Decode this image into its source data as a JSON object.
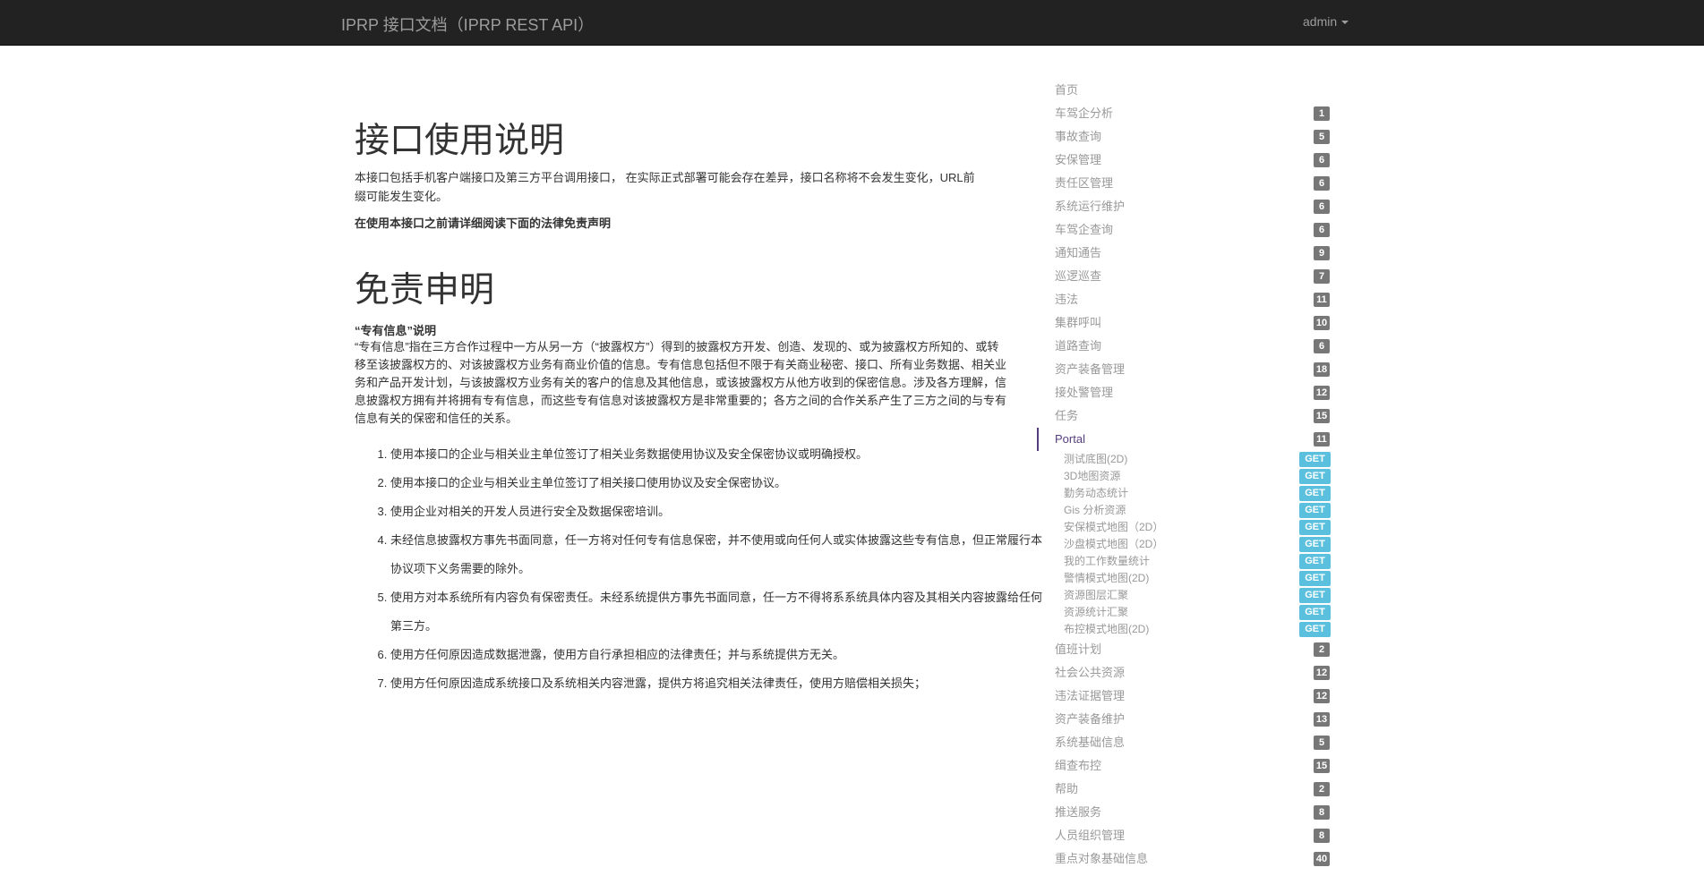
{
  "navbar": {
    "brand": "IPRP 接口文档（IPRP REST API）",
    "user": "admin"
  },
  "main": {
    "usage_title": "接口使用说明",
    "intro": "本接口包括手机客户端接口及第三方平台调用接口， 在实际正式部署可能会存在差异，接口名称将不会发生变化，URL前缀可能发生变化。",
    "warning": "在使用本接口之前请详细阅读下面的法律免责声明",
    "disclaimer_title": "免责申明",
    "proprietary_title": "“专有信息”说明",
    "proprietary_text": "“专有信息”指在三方合作过程中一方从另一方（“披露权方”）得到的披露权方开发、创造、发现的、或为披露权方所知的、或转移至该披露权方的、对该披露权方业务有商业价值的信息。专有信息包括但不限于有关商业秘密、接口、所有业务数据、相关业务和产品开发计划，与该披露权方业务有关的客户的信息及其他信息，或该披露权方从他方收到的保密信息。涉及各方理解，信息披露权方拥有并将拥有专有信息，而这些专有信息对该披露权方是非常重要的；各方之间的合作关系产生了三方之间的与专有信息有关的保密和信任的关系。",
    "terms": [
      "使用本接口的企业与相关业主单位签订了相关业务数据使用协议及安全保密协议或明确授权。",
      "使用本接口的企业与相关业主单位签订了相关接口使用协议及安全保密协议。",
      "使用企业对相关的开发人员进行安全及数据保密培训。",
      "未经信息披露权方事先书面同意，任一方将对任何专有信息保密，并不使用或向任何人或实体披露这些专有信息，但正常履行本协议项下义务需要的除外。",
      "使用方对本系统所有内容负有保密责任。未经系统提供方事先书面同意，任一方不得将系系统具体内容及其相关内容披露给任何第三方。",
      "使用方任何原因造成数据泄露，使用方自行承担相应的法律责任；并与系统提供方无关。",
      "使用方任何原因造成系统接口及系统相关内容泄露，提供方将追究相关法律责任，使用方赔偿相关损失；"
    ]
  },
  "sidebar": {
    "home": "首页",
    "items_before": [
      {
        "label": "车驾企分析",
        "count": "1"
      },
      {
        "label": "事故查询",
        "count": "5"
      },
      {
        "label": "安保管理",
        "count": "6"
      },
      {
        "label": "责任区管理",
        "count": "6"
      },
      {
        "label": "系统运行维护",
        "count": "6"
      },
      {
        "label": "车驾企查询",
        "count": "6"
      },
      {
        "label": "通知通告",
        "count": "9"
      },
      {
        "label": "巡逻巡查",
        "count": "7"
      },
      {
        "label": "违法",
        "count": "11"
      },
      {
        "label": "集群呼叫",
        "count": "10"
      },
      {
        "label": "道路查询",
        "count": "6"
      },
      {
        "label": "资产装备管理",
        "count": "18"
      },
      {
        "label": "接处警管理",
        "count": "12"
      },
      {
        "label": "任务",
        "count": "15"
      }
    ],
    "active": {
      "label": "Portal",
      "count": "11"
    },
    "sub_items": [
      {
        "label": "测试底图(2D)",
        "method": "GET"
      },
      {
        "label": "3D地图资源",
        "method": "GET"
      },
      {
        "label": "勤务动态统计",
        "method": "GET"
      },
      {
        "label": "Gis 分析资源",
        "method": "GET"
      },
      {
        "label": "安保模式地图（2D）",
        "method": "GET"
      },
      {
        "label": "沙盘模式地图（2D）",
        "method": "GET"
      },
      {
        "label": "我的工作数量统计",
        "method": "GET"
      },
      {
        "label": "警情模式地图(2D)",
        "method": "GET"
      },
      {
        "label": "资源图层汇聚",
        "method": "GET"
      },
      {
        "label": "资源统计汇聚",
        "method": "GET"
      },
      {
        "label": "布控模式地图(2D)",
        "method": "GET"
      }
    ],
    "items_after": [
      {
        "label": "值班计划",
        "count": "2"
      },
      {
        "label": "社会公共资源",
        "count": "12"
      },
      {
        "label": "违法证据管理",
        "count": "12"
      },
      {
        "label": "资产装备维护",
        "count": "13"
      },
      {
        "label": "系统基础信息",
        "count": "5"
      },
      {
        "label": "缉查布控",
        "count": "15"
      },
      {
        "label": "帮助",
        "count": "2"
      },
      {
        "label": "推送服务",
        "count": "8"
      },
      {
        "label": "人员组织管理",
        "count": "8"
      },
      {
        "label": "重点对象基础信息",
        "count": "40"
      }
    ]
  }
}
